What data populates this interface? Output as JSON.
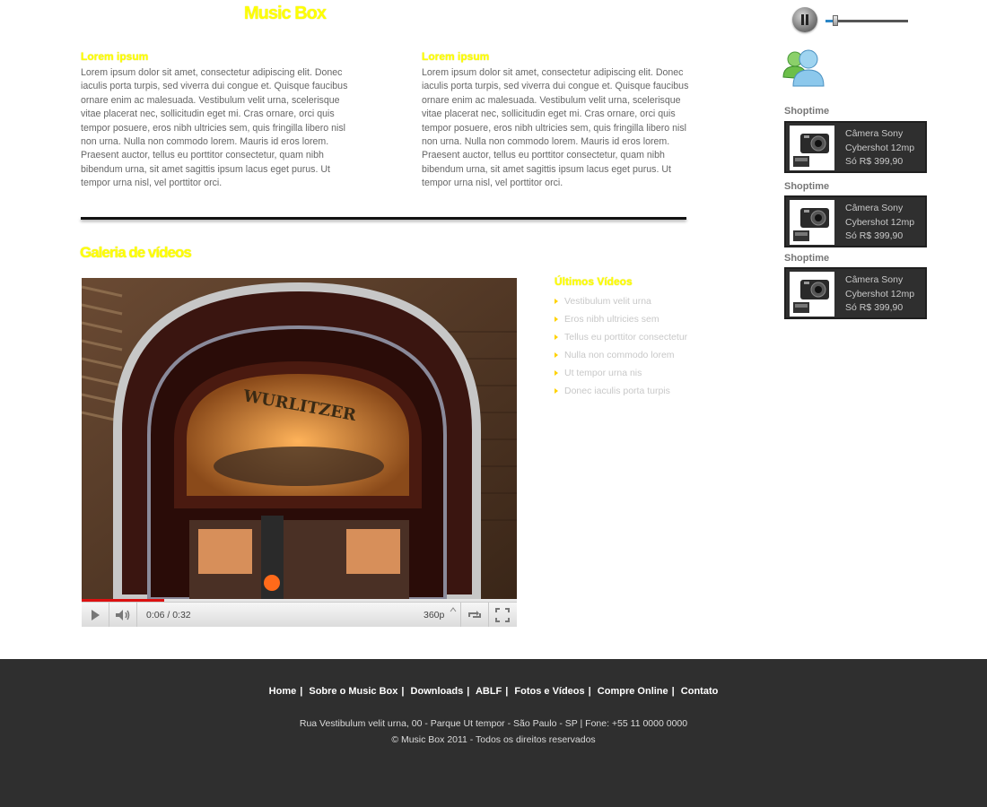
{
  "header": {
    "title": "Music Box"
  },
  "columns": [
    {
      "title": "Lorem ipsum",
      "text": "Lorem ipsum dolor sit amet, consectetur adipiscing elit. Donec iaculis porta turpis, sed viverra dui congue et. Quisque faucibus ornare enim ac malesuada. Vestibulum velit urna, scelerisque vitae placerat nec, sollicitudin eget mi. Cras ornare, orci quis tempor posuere, eros nibh ultricies sem, quis fringilla libero nisl non urna. Nulla non commodo lorem. Mauris id eros lorem. Praesent auctor, tellus eu porttitor consectetur, quam nibh bibendum urna, sit amet sagittis ipsum lacus eget purus. Ut tempor urna nisl, vel porttitor orci."
    },
    {
      "title": "Lorem ipsum",
      "text": "Lorem ipsum dolor sit amet, consectetur adipiscing elit. Donec iaculis porta turpis, sed viverra dui congue et. Quisque faucibus ornare enim ac malesuada. Vestibulum velit urna, scelerisque vitae placerat nec, sollicitudin eget mi. Cras ornare, orci quis tempor posuere, eros nibh ultricies sem, quis fringilla libero nisl non urna. Nulla non commodo lorem. Mauris id eros lorem. Praesent auctor, tellus eu porttitor consectetur, quam nibh bibendum urna, sit amet sagittis ipsum lacus eget purus. Ut tempor urna nisl, vel porttitor orci."
    }
  ],
  "gallery": {
    "title": "Galeria de vídeos",
    "player": {
      "time": "0:06 / 0:32",
      "quality": "360p",
      "progress": 0.19,
      "play_icon": "play-icon",
      "volume_icon": "volume-icon",
      "repeat_icon": "repeat-icon",
      "fullscreen_icon": "fullscreen-icon"
    },
    "latest": {
      "title": "Últimos Vídeos",
      "items": [
        "Vestibulum velit urna",
        "Eros nibh ultricies sem",
        "Tellus eu porttitor consectetur",
        "Nulla non commodo lorem",
        "Ut tempor urna nis",
        "Donec iaculis porta turpis"
      ]
    }
  },
  "sidebar": {
    "audio": {
      "volume": 0.1
    },
    "shoptime": [
      {
        "label": "Shoptime",
        "line1": "Câmera Sony",
        "line2": "Cybershot 12mp",
        "price": "Só R$ 399,90"
      },
      {
        "label": "Shoptime",
        "line1": "Câmera Sony",
        "line2": "Cybershot 12mp",
        "price": "Só R$ 399,90"
      },
      {
        "label": "Shoptime",
        "line1": "Câmera Sony",
        "line2": "Cybershot 12mp",
        "price": "Só R$ 399,90"
      }
    ]
  },
  "footer": {
    "nav": [
      "Home",
      "Sobre o Music Box",
      "Downloads",
      "ABLF",
      "Fotos e Vídeos",
      "Compre Online",
      "Contato"
    ],
    "address": "Rua Vestibulum velit urna, 00 - Parque Ut tempor  - São Paulo - SP |  Fone: +55 11 0000 0000",
    "copyright": "© Music Box 2011 - Todos os direitos reservados"
  },
  "colors": {
    "accent": "#ffff00",
    "footer_bg": "#2f2f2f",
    "progress": "#dd1111",
    "volume": "#2b86c6"
  }
}
